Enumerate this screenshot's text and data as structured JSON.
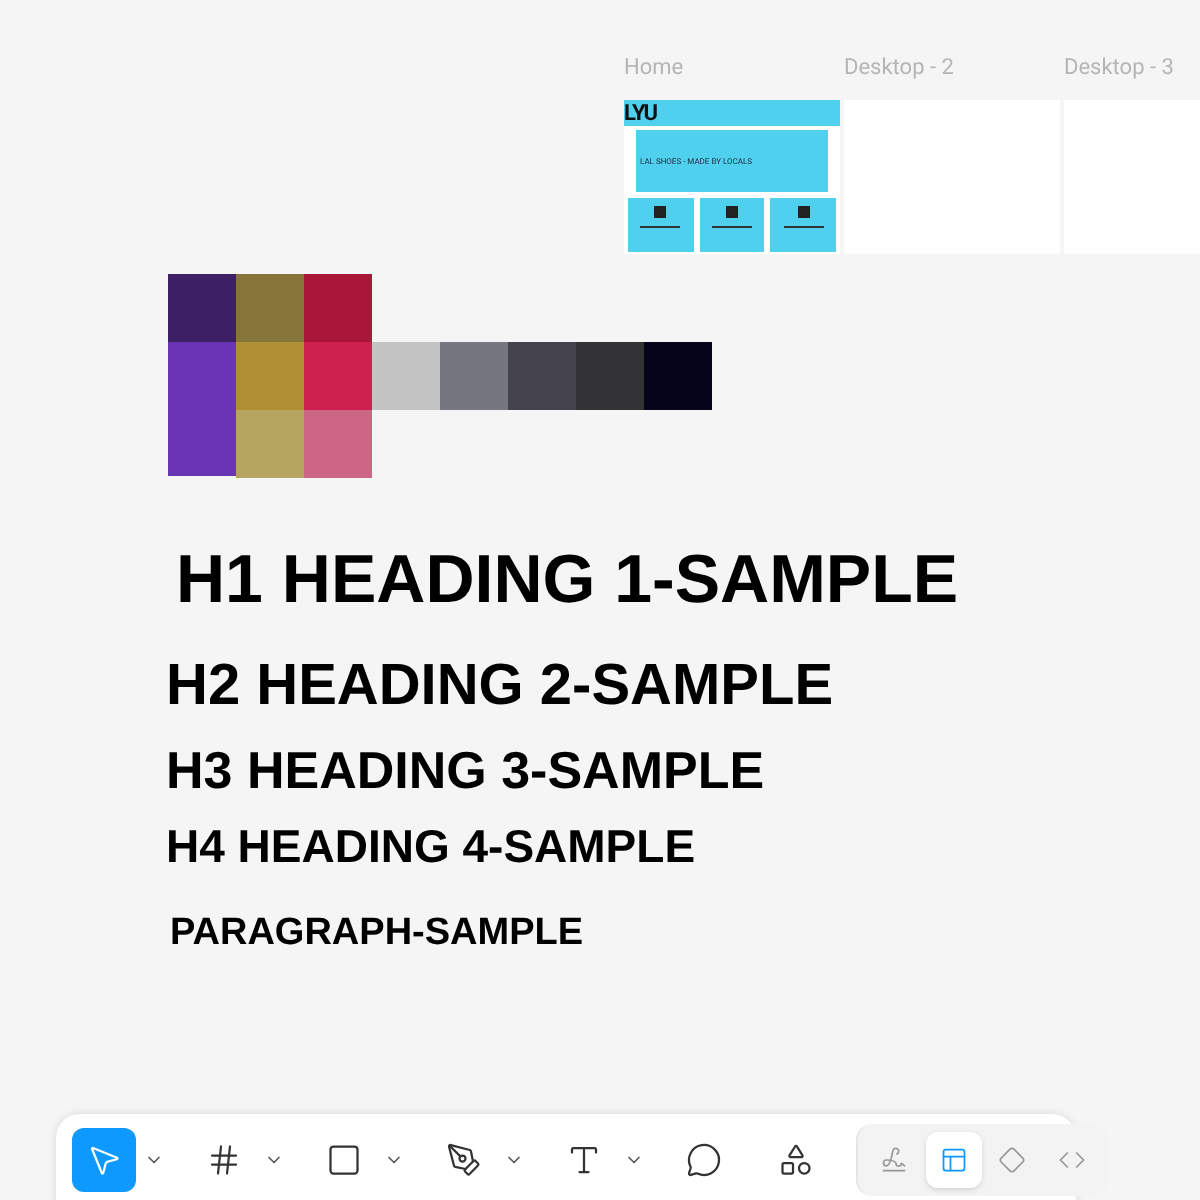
{
  "frames": [
    {
      "label": "Home",
      "kind": "home",
      "logo": "LYU",
      "banner": "LAL SHOES - MADE BY LOCALS"
    },
    {
      "label": "Desktop - 2",
      "kind": "blank"
    },
    {
      "label": "Desktop - 3",
      "kind": "blank"
    }
  ],
  "palette": {
    "columns": [
      {
        "swatches": [
          {
            "color": "#3d1f66"
          },
          {
            "color": "#6a35b4"
          }
        ]
      },
      {
        "swatches": [
          {
            "color": "#857538"
          },
          {
            "color": "#b08f35"
          },
          {
            "color": "#b5a561"
          }
        ]
      },
      {
        "swatches": [
          {
            "color": "#a91738"
          },
          {
            "color": "#cf2150"
          },
          {
            "color": "#cd6585"
          }
        ]
      }
    ],
    "grays": [
      {
        "color": "#c4c4c4"
      },
      {
        "color": "#76767f"
      },
      {
        "color": "#45444d"
      },
      {
        "color": "#323237"
      },
      {
        "color": "#05041a"
      }
    ]
  },
  "headings": [
    {
      "kind": "h1",
      "text": "H1 HEADING 1-SAMPLE"
    },
    {
      "kind": "h2",
      "text": "H2 HEADING 2-SAMPLE"
    },
    {
      "kind": "h3",
      "text": "H3 HEADING 3-SAMPLE"
    },
    {
      "kind": "h4",
      "text": "H4 HEADING 4-SAMPLE"
    },
    {
      "kind": "p",
      "text": "PARAGRAPH-SAMPLE"
    }
  ],
  "toolbar": {
    "tools": [
      {
        "kind": "move",
        "selected": true,
        "menu": true
      },
      {
        "kind": "frame",
        "selected": false,
        "menu": true
      },
      {
        "kind": "shape",
        "selected": false,
        "menu": true
      },
      {
        "kind": "pen",
        "selected": false,
        "menu": true
      },
      {
        "kind": "text",
        "selected": false,
        "menu": true
      },
      {
        "kind": "comment",
        "selected": false,
        "menu": false
      },
      {
        "kind": "actions",
        "selected": false,
        "menu": false
      }
    ],
    "modes": [
      {
        "kind": "draw",
        "selected": false
      },
      {
        "kind": "design",
        "selected": true
      },
      {
        "kind": "prototype",
        "selected": false
      },
      {
        "kind": "dev",
        "selected": false
      }
    ]
  }
}
